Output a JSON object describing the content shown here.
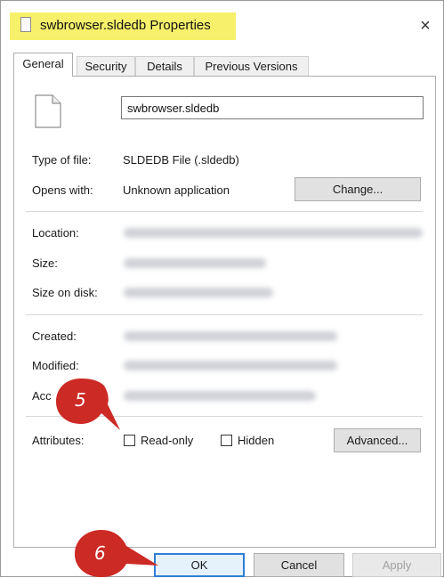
{
  "window": {
    "title": "swbrowser.sldedb Properties",
    "close_glyph": "×"
  },
  "tabs": [
    {
      "label": "General",
      "active": true
    },
    {
      "label": "Security",
      "active": false
    },
    {
      "label": "Details",
      "active": false
    },
    {
      "label": "Previous Versions",
      "active": false
    }
  ],
  "general": {
    "filename": "swbrowser.sldedb",
    "type_label": "Type of file:",
    "type_value": "SLDEDB File (.sldedb)",
    "opens_label": "Opens with:",
    "opens_value": "Unknown application",
    "change_label": "Change...",
    "location_label": "Location:",
    "size_label": "Size:",
    "size_on_disk_label": "Size on disk:",
    "created_label": "Created:",
    "modified_label": "Modified:",
    "accessed_label": "Acc",
    "attributes_label": "Attributes:",
    "readonly_label": "Read-only",
    "hidden_label": "Hidden",
    "advanced_label": "Advanced..."
  },
  "footer": {
    "ok_label": "OK",
    "cancel_label": "Cancel",
    "apply_label": "Apply"
  },
  "annotations": {
    "step_5": "5",
    "step_6": "6",
    "marker_color": "#cc2a25"
  }
}
